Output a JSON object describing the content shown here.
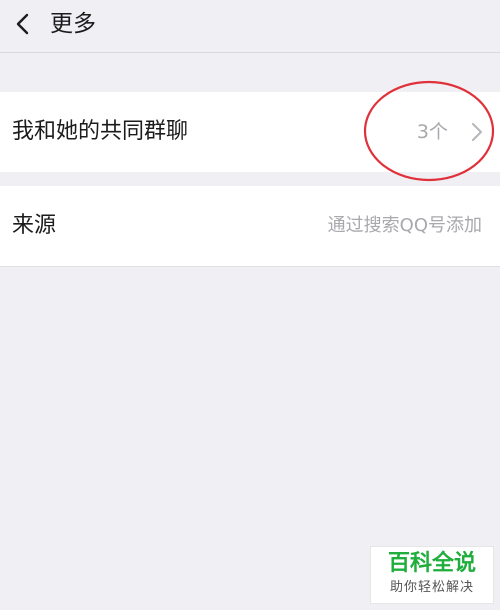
{
  "header": {
    "title": "更多",
    "back_icon": "chevron-left-icon"
  },
  "rows": {
    "common_groups": {
      "label": "我和她的共同群聊",
      "value": "3个",
      "icon": "chevron-right-icon",
      "highlight_color": "#e0303a"
    },
    "source": {
      "label": "来源",
      "value": "通过搜索QQ号添加"
    }
  },
  "watermark": {
    "main": "百科全说",
    "sub": "助你轻松解决",
    "color": "#1fae3c"
  }
}
